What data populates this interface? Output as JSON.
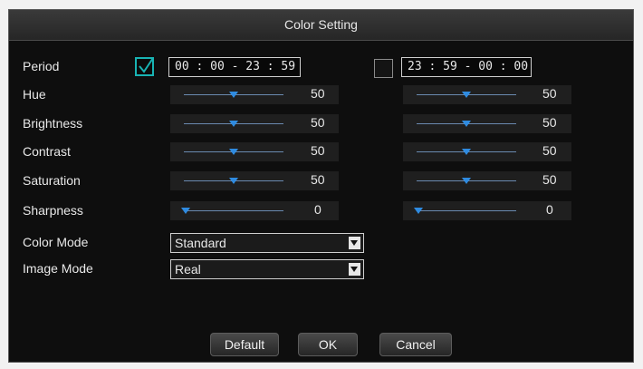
{
  "dialog": {
    "title": "Color Setting"
  },
  "labels": {
    "period": "Period",
    "hue": "Hue",
    "brightness": "Brightness",
    "contrast": "Contrast",
    "saturation": "Saturation",
    "sharpness": "Sharpness",
    "color_mode": "Color Mode",
    "image_mode": "Image Mode"
  },
  "period1": {
    "checked": true,
    "time": "00 : 00 - 23 : 59"
  },
  "period2": {
    "checked": false,
    "time": "23 : 59 - 00 : 00"
  },
  "period1_values": {
    "hue": "50",
    "brightness": "50",
    "contrast": "50",
    "saturation": "50",
    "sharpness": "0"
  },
  "period2_values": {
    "hue": "50",
    "brightness": "50",
    "contrast": "50",
    "saturation": "50",
    "sharpness": "0"
  },
  "color_mode": {
    "selected": "Standard"
  },
  "image_mode": {
    "selected": "Real"
  },
  "buttons": {
    "default": "Default",
    "ok": "OK",
    "cancel": "Cancel"
  },
  "colors": {
    "accent_check": "#18b3b3",
    "slider_thumb": "#2f8be0"
  },
  "icons": {
    "checkbox": "checkmark-icon",
    "dropdown": "chevron-down-icon"
  }
}
